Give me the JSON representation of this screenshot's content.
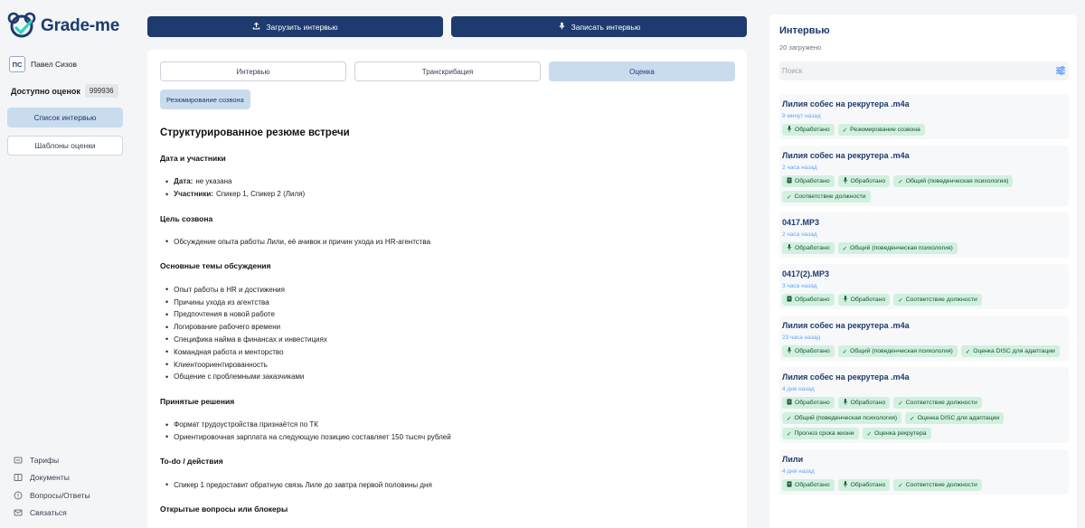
{
  "app": {
    "name": "Grade-me"
  },
  "user": {
    "initials": "ПС",
    "name": "Павел Сизов"
  },
  "credits": {
    "label": "Доступно оценок",
    "value": "999936"
  },
  "sidebar": {
    "interviews_list": "Список интервью",
    "templates": "Шаблоны оценки",
    "links": [
      {
        "label": "Тарифы",
        "icon": "pricing-icon"
      },
      {
        "label": "Документы",
        "icon": "documents-icon"
      },
      {
        "label": "Вопросы/Ответы",
        "icon": "faq-icon"
      },
      {
        "label": "Связаться",
        "icon": "mail-icon"
      }
    ]
  },
  "actions": {
    "upload": "Загрузить интервью",
    "record": "Записать интервью"
  },
  "tabs": [
    "Интервью",
    "Транскрибация",
    "Оценка"
  ],
  "active_tab": "Оценка",
  "summary_button": "Резюмирование созвона",
  "report": {
    "title": "Структурированное резюме встречи",
    "sections": [
      {
        "heading": "Дата и участники",
        "items": [
          {
            "bold": "Дата:",
            "text": "не указана"
          },
          {
            "bold": "Участники:",
            "text": "Спикер 1, Спикер 2 (Лиля)"
          }
        ]
      },
      {
        "heading": "Цель созвона",
        "items": [
          {
            "bold": "",
            "text": "Обсуждение опыта работы Лили, её ачивок и причин ухода из HR-агентства"
          }
        ]
      },
      {
        "heading": "Основные темы обсуждения",
        "items": [
          {
            "bold": "",
            "text": "Опыт работы в HR и достижения"
          },
          {
            "bold": "",
            "text": "Причины ухода из агентства"
          },
          {
            "bold": "",
            "text": "Предпочтения в новой работе"
          },
          {
            "bold": "",
            "text": "Логирование рабочего времени"
          },
          {
            "bold": "",
            "text": "Специфика найма в финансах и инвестициях"
          },
          {
            "bold": "",
            "text": "Командная работа и менторство"
          },
          {
            "bold": "",
            "text": "Клиентоориентированность"
          },
          {
            "bold": "",
            "text": "Общение с проблемными заказчиками"
          }
        ]
      },
      {
        "heading": "Принятые решения",
        "items": [
          {
            "bold": "",
            "text": "Формат трудоустройства признаётся по ТК"
          },
          {
            "bold": "",
            "text": "Ориентировочная зарплата на следующую позицию составляет 150 тысяч рублей"
          }
        ]
      },
      {
        "heading": "To-do / действия",
        "items": [
          {
            "bold": "",
            "text": "Спикер 1 предоставит обратную связь Лиле до завтра первой половины дня"
          }
        ]
      },
      {
        "heading": "Открытые вопросы или блокеры",
        "items": []
      }
    ]
  },
  "interviews": {
    "title": "Интервью",
    "count": "20 загружено",
    "search_placeholder": "Поиск",
    "items": [
      {
        "title": "Лилия собес на рекрутера .m4a",
        "time": "9 минут назад",
        "badges": [
          {
            "icon": "mic",
            "label": "Обработано"
          },
          {
            "icon": "check",
            "label": "Резюмирование созвона"
          }
        ]
      },
      {
        "title": "Лилия собес на рекрутера .m4a",
        "time": "2 часа назад",
        "badges": [
          {
            "icon": "doc",
            "label": "Обработано"
          },
          {
            "icon": "mic",
            "label": "Обработано"
          },
          {
            "icon": "check",
            "label": "Общий (поведенческая психология)"
          },
          {
            "icon": "check",
            "label": "Соответствие должности"
          }
        ]
      },
      {
        "title": "0417.MP3",
        "time": "2 часа назад",
        "badges": [
          {
            "icon": "mic",
            "label": "Обработано"
          },
          {
            "icon": "check",
            "label": "Общий (поведенческая психология)"
          }
        ]
      },
      {
        "title": "0417(2).MP3",
        "time": "3 часа назад",
        "badges": [
          {
            "icon": "doc",
            "label": "Обработано"
          },
          {
            "icon": "mic",
            "label": "Обработано"
          },
          {
            "icon": "check",
            "label": "Соответствие должности"
          }
        ]
      },
      {
        "title": "Лилия собес на рекрутера .m4a",
        "time": "23 часа назад",
        "badges": [
          {
            "icon": "mic",
            "label": "Обработано"
          },
          {
            "icon": "check",
            "label": "Общий (поведенческая психология)"
          },
          {
            "icon": "check",
            "label": "Оценка DISC для адаптации"
          }
        ]
      },
      {
        "title": "Лилия собес на рекрутера .m4a",
        "time": "4 дня назад",
        "badges": [
          {
            "icon": "doc",
            "label": "Обработано"
          },
          {
            "icon": "mic",
            "label": "Обработано"
          },
          {
            "icon": "check",
            "label": "Соответствие должности"
          },
          {
            "icon": "check",
            "label": "Общий (поведенческая психология)"
          },
          {
            "icon": "check",
            "label": "Оценка DISC для адаптации"
          },
          {
            "icon": "check",
            "label": "Прогноз срока жизни"
          },
          {
            "icon": "check",
            "label": "Оценка рекрутера"
          }
        ]
      },
      {
        "title": "Лили",
        "time": "4 дня назад",
        "badges": [
          {
            "icon": "doc",
            "label": "Обработано"
          },
          {
            "icon": "mic",
            "label": "Обработано"
          },
          {
            "icon": "check",
            "label": "Соответствие должности"
          }
        ]
      }
    ]
  },
  "colors": {
    "brand": "#1e3a6e",
    "accent_light": "#c9dcee",
    "badge_bg": "#d1f0df",
    "time": "#60a5fa"
  }
}
